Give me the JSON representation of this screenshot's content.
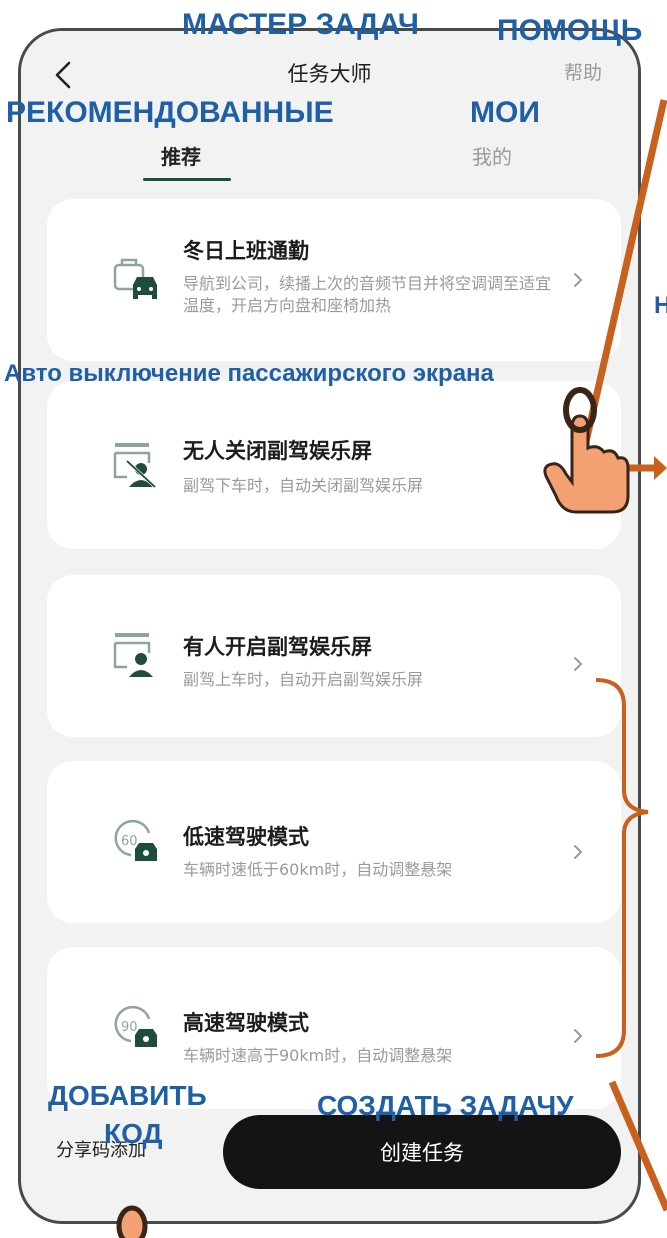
{
  "header": {
    "title": "任务大师",
    "help_label": "帮助",
    "tabs": [
      {
        "label": "推荐",
        "active": true
      },
      {
        "label": "我的",
        "active": false
      }
    ]
  },
  "cards": [
    {
      "title": "冬日上班通勤",
      "description": "导航到公司，续播上次的音频节目并将空调调至适宜温度，开启方向盘和座椅加热",
      "icon": "car-commute-icon"
    },
    {
      "title": "无人关闭副驾娱乐屏",
      "description": "副驾下车时，自动关闭副驾娱乐屏",
      "icon": "passenger-screen-off-icon"
    },
    {
      "title": "有人开启副驾娱乐屏",
      "description": "副驾上车时，自动开启副驾娱乐屏",
      "icon": "passenger-screen-on-icon"
    },
    {
      "title": "低速驾驶模式",
      "description": "车辆时速低于60km时，自动调整悬架",
      "icon": "speed-60-icon"
    },
    {
      "title": "高速驾驶模式",
      "description": "车辆时速高于90km时，自动调整悬架",
      "icon": "speed-90-icon"
    }
  ],
  "footer": {
    "add_by_code_label": "分享码添加",
    "create_label": "创建任务"
  },
  "annotations": {
    "title": "МАСТЕР ЗАДАЧ",
    "help": "ПОМОЩЬ",
    "recommended": "РЕКОМЕНДОВАННЫЕ",
    "mine": "МОИ",
    "auto_off": "Авто выключение пассажирского экрана",
    "add_code_line1": "ДОБАВИТЬ",
    "add_code_line2": "КОД",
    "create_task": "СОЗДАТЬ ЗАДАЧУ",
    "edge_letter": "Н"
  },
  "colors": {
    "accent_green": "#1f4d3a",
    "annotation_blue": "#1f5fa6",
    "annotation_orange": "#c8601e",
    "button_dark": "#141414"
  }
}
